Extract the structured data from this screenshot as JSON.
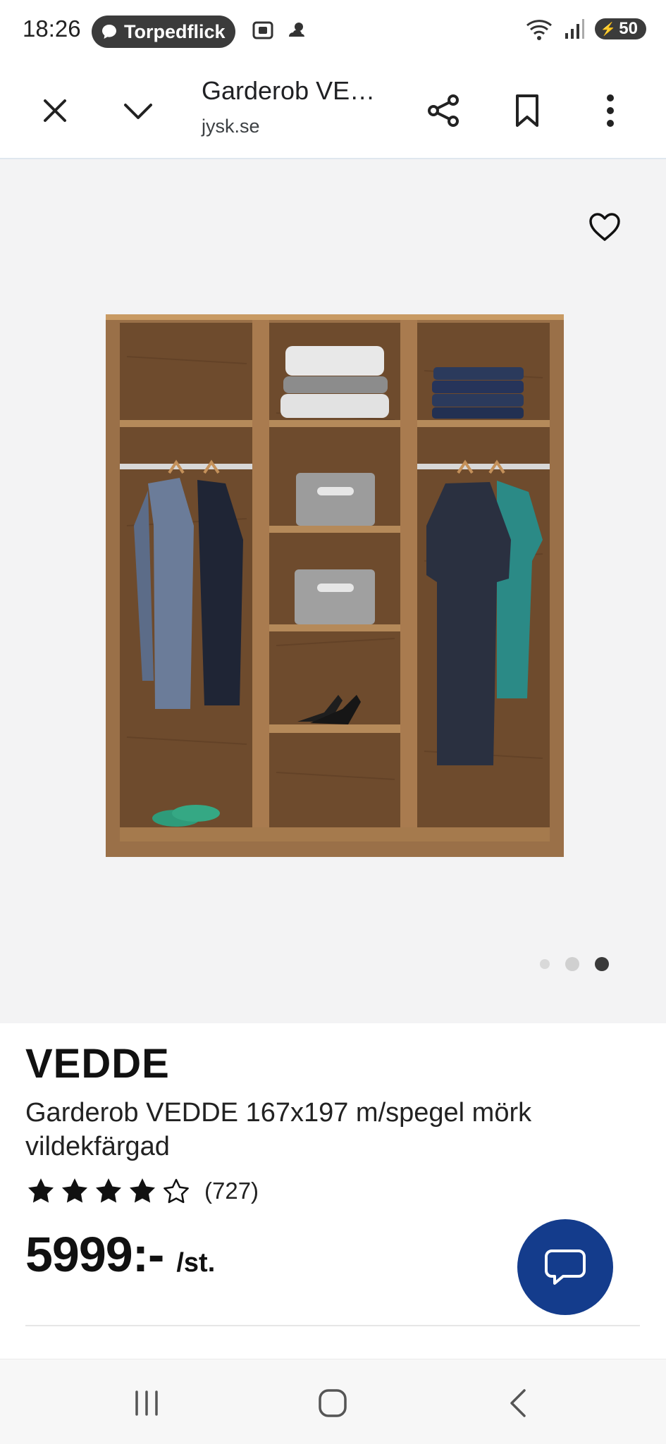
{
  "status_bar": {
    "time": "18:26",
    "notification_app": "Torpedflick",
    "battery": "50"
  },
  "toolbar": {
    "tab_title": "Garderob VE…",
    "tab_url": "jysk.se"
  },
  "gallery": {
    "image_count": 3,
    "active_index": 3
  },
  "product": {
    "brand": "VEDDE",
    "description": "Garderob VEDDE 167x197 m/spegel mörk vildekfärgad",
    "rating_stars": 4,
    "rating_max": 5,
    "rating_count": "(727)",
    "price": "5999:-",
    "price_unit": "/st."
  },
  "colors": {
    "chat_button": "#143c8c",
    "hero_background": "#f3f3f4",
    "wood": "#9a7048"
  },
  "icons": [
    "close-icon",
    "chevron-down-icon",
    "share-icon",
    "bookmark-icon",
    "more-vertical-icon",
    "heart-icon",
    "chat-icon",
    "recent-apps-icon",
    "home-icon",
    "back-icon"
  ]
}
